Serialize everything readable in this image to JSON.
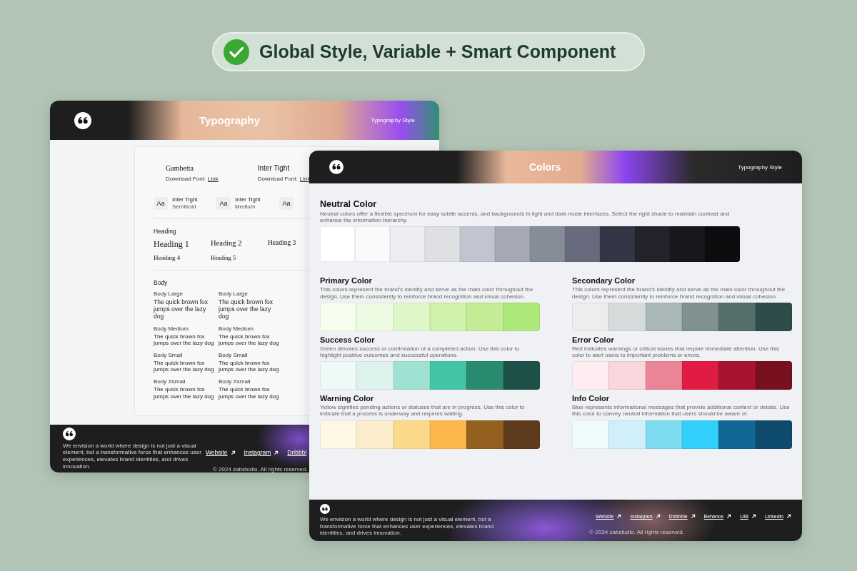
{
  "badge": {
    "text": "Global Style, Variable + Smart Component"
  },
  "typography_window": {
    "title": "Typography",
    "nav": "Typography Style",
    "fonts": [
      {
        "name": "Gambetta",
        "kind": "serif",
        "download_label": "Download Font:",
        "link": "Link"
      },
      {
        "name": "Inter Tight",
        "kind": "sans",
        "download_label": "Download Font:",
        "link": "Link"
      }
    ],
    "weights": [
      {
        "sample": "Aa",
        "family": "Inter Tight",
        "weight": "Semibold"
      },
      {
        "sample": "Aa",
        "family": "Inter Tight",
        "weight": "Medium"
      },
      {
        "sample": "Aa"
      }
    ],
    "heading_section": {
      "title": "Heading",
      "items": [
        {
          "text": "Heading 1",
          "kind": "h1"
        },
        {
          "text": "Heading 2",
          "kind": "h2"
        },
        {
          "text": "Heading 3",
          "kind": "h3"
        },
        {
          "text": "Heading 4",
          "kind": "h4"
        },
        {
          "text": "Heading 5",
          "kind": "h5"
        }
      ]
    },
    "body_section": {
      "title": "Body",
      "rows": [
        {
          "kind": "large",
          "cells": [
            {
              "label": "Body Large",
              "sample": "The quick brown fox jumps over the lazy dog"
            },
            {
              "label": "Body Large",
              "sample": "The quick brown fox jumps over the lazy dog"
            }
          ]
        },
        {
          "kind": "medium",
          "cells": [
            {
              "label": "Body Medium",
              "sample": "The quick brown fox jumps over the lazy dog"
            },
            {
              "label": "Body Medium",
              "sample": "The quick brown fox jumps over the lazy dog"
            }
          ]
        },
        {
          "kind": "small",
          "cells": [
            {
              "label": "Body Small",
              "sample": "The quick brown fox jumps over the lazy dog"
            },
            {
              "label": "Body Small",
              "sample": "The quick brown fox jumps over the lazy dog"
            }
          ]
        },
        {
          "kind": "xsmall",
          "cells": [
            {
              "label": "Body Xsmall",
              "sample": "The quick brown fox jumps over the lazy dog"
            },
            {
              "label": "Body Xsmall",
              "sample": "The quick brown fox jumps over the lazy dog"
            }
          ]
        }
      ]
    },
    "footer": {
      "text": "We envision a world where design is not just a visual element, but a transformative force that enhances user experiences, elevates brand identities, and drives innovation.",
      "links": [
        {
          "label": "Website",
          "arrow": true
        },
        {
          "label": "Instagram",
          "arrow": true
        },
        {
          "label": "Dribbbl",
          "arrow": false
        }
      ],
      "copyright": "© 2024 zabstudio. All rights reserved."
    }
  },
  "colors_window": {
    "title": "Colors",
    "nav": "Typography Style",
    "sections": [
      {
        "title": "Neutral Color",
        "kind": "wide",
        "description": "Neutral colors offer a flexible spectrum for easy subtle accents, and backgrounds in light and dark mode interfaces. Select the right shade to maintain contrast and enhance the information hierarchy.",
        "swatches": [
          {
            "color": "#ffffff"
          },
          {
            "color": "#fafafb"
          },
          {
            "color": "#eceef1"
          },
          {
            "color": "#dfe0e3"
          },
          {
            "color": "#c0c5cf"
          },
          {
            "color": "#a4a9b5"
          },
          {
            "color": "#878c99"
          },
          {
            "color": "#676b7d"
          },
          {
            "color": "#353645"
          },
          {
            "color": "#22232b"
          },
          {
            "color": "#17171c"
          },
          {
            "color": "#0c0c0f"
          }
        ]
      },
      {
        "title": "Primary Color",
        "kind": "half",
        "description": "This colors represent the brand's identity and serve as the main color throughout the design. Use them consistently to reinforce brand recognition and visual cohesion.",
        "swatches": [
          {
            "color": "#f6ffee"
          },
          {
            "color": "#eefbe3"
          },
          {
            "color": "#def7c9"
          },
          {
            "color": "#d1f2ab"
          },
          {
            "color": "#c3ec95"
          },
          {
            "color": "#ade97a"
          }
        ]
      },
      {
        "title": "Secondary Color",
        "kind": "half",
        "description": "This colors represent the brand's identity and serve as the main color throughout the design. Use them consistently to reinforce brand recognition and visual cohesion.",
        "swatches": [
          {
            "color": "#ebeeed"
          },
          {
            "color": "#d5dcdb"
          },
          {
            "color": "#a9b8b6"
          },
          {
            "color": "#7f9290"
          },
          {
            "color": "#556d6b"
          },
          {
            "color": "#2e4c4a"
          }
        ]
      },
      {
        "title": "Success Color",
        "kind": "half",
        "description": "Green denotes success or confirmation of a completed action. Use this color to highlight positive outcomes and successful operations.",
        "swatches": [
          {
            "color": "#eefaf7"
          },
          {
            "color": "#def3ee"
          },
          {
            "color": "#9fe2d3"
          },
          {
            "color": "#43c5a5"
          },
          {
            "color": "#298a70"
          },
          {
            "color": "#1c5048"
          }
        ]
      },
      {
        "title": "Error Color",
        "kind": "half",
        "description": "Red indicates warnings or critical issues that require immediate attention. Use this color to alert users to important problems or errors.",
        "swatches": [
          {
            "color": "#fdedf0"
          },
          {
            "color": "#f9d6dc"
          },
          {
            "color": "#ea8497"
          },
          {
            "color": "#e11c44"
          },
          {
            "color": "#a71330"
          },
          {
            "color": "#77101f"
          }
        ]
      },
      {
        "title": "Warning Color",
        "kind": "half",
        "description": "Yellow signifies pending actions or statuses that are in progress. Use this color to indicate that a process is underway and requires waiting.",
        "swatches": [
          {
            "color": "#fef7e6"
          },
          {
            "color": "#fbeccb"
          },
          {
            "color": "#fbd98a"
          },
          {
            "color": "#fdb84c"
          },
          {
            "color": "#94601f"
          },
          {
            "color": "#5e3b1d"
          }
        ]
      },
      {
        "title": "Info Color",
        "kind": "half",
        "description": "Blue represents informational messages that provide additional context or details. Use this color to convey neutral information that users should be aware of.",
        "swatches": [
          {
            "color": "#f0fbfe"
          },
          {
            "color": "#d1effb"
          },
          {
            "color": "#7ddcef"
          },
          {
            "color": "#31cff9"
          },
          {
            "color": "#116896"
          },
          {
            "color": "#0e4b6d"
          }
        ]
      }
    ],
    "footer": {
      "text": "We envision a world where design is not just a visual element, but a transformative force that enhances user experiences, elevates brand identities, and drives innovation.",
      "links": [
        {
          "label": "Website",
          "arrow": true
        },
        {
          "label": "Instagram",
          "arrow": true
        },
        {
          "label": "Dribbble",
          "arrow": true
        },
        {
          "label": "Behance",
          "arrow": true
        },
        {
          "label": "UIB",
          "arrow": true
        },
        {
          "label": "Linkedin",
          "arrow": true
        }
      ],
      "copyright": "© 2024 zabstudio. All rights reserved."
    }
  }
}
